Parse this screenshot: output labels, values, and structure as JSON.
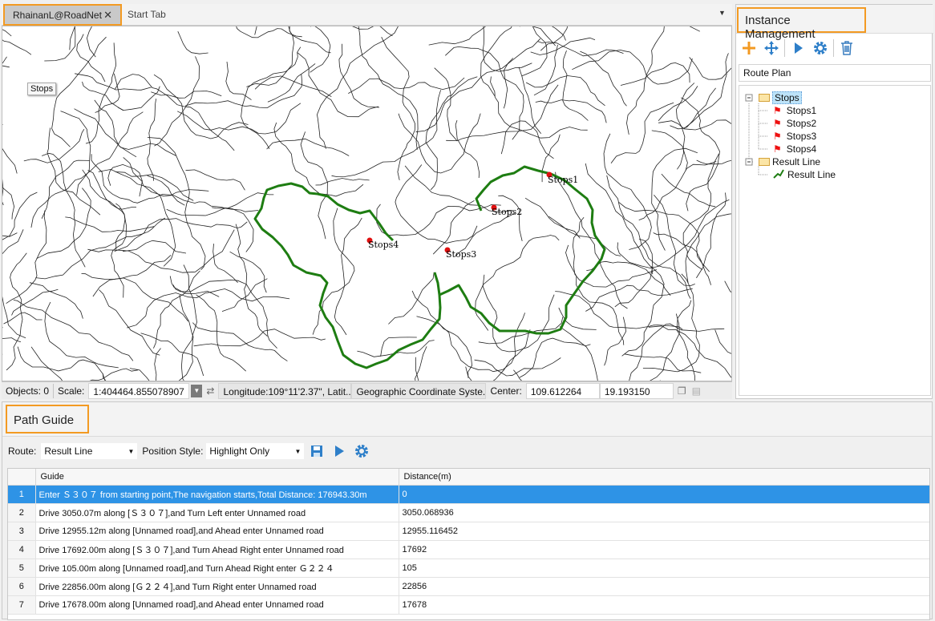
{
  "map_tabs": {
    "active": "RhainanL@RoadNet",
    "close_glyph": "✕",
    "inactive": "Start Tab",
    "dropdown_glyph": "▼"
  },
  "map": {
    "tooltip": "Stops",
    "stops": [
      {
        "label": "Stops1"
      },
      {
        "label": "Stops2"
      },
      {
        "label": "Stops3"
      },
      {
        "label": "Stops4"
      }
    ],
    "route_color": "#1e7d12",
    "stop_color": "#e01010"
  },
  "status_bar": {
    "objects_label": "Objects: 0",
    "scale_label": "Scale:",
    "scale_value": "1:404464.855078907",
    "longitude": "Longitude:109°11'2.37\", Latit...",
    "coord_system": "Geographic Coordinate Syste...",
    "center_label": "Center:",
    "center_x": "109.612264",
    "center_y": "19.193150"
  },
  "instance_panel": {
    "title": "Instance Management",
    "tools": [
      "add-icon",
      "move-icon",
      "run-icon",
      "settings-icon",
      "delete-icon"
    ],
    "route_plan": "Route Plan",
    "tree": {
      "stops_group": "Stops",
      "stops": [
        "Stops1",
        "Stops2",
        "Stops3",
        "Stops4"
      ],
      "result_group": "Result Line",
      "result_item": "Result Line"
    }
  },
  "path_guide": {
    "title": "Path Guide",
    "route_label": "Route:",
    "route_value": "Result Line",
    "position_label": "Position Style:",
    "position_value": "Highlight Only",
    "columns": [
      "Guide",
      "Distance(m)"
    ],
    "rows": [
      {
        "n": "1",
        "guide": "Enter Ｓ３０７ from starting point,The navigation starts,Total Distance: 176943.30m",
        "distance": "0"
      },
      {
        "n": "2",
        "guide": "Drive 3050.07m along [Ｓ３０７],and Turn Left enter Unnamed road",
        "distance": "3050.068936"
      },
      {
        "n": "3",
        "guide": "Drive 12955.12m along [Unnamed road],and Ahead enter Unnamed road",
        "distance": "12955.116452"
      },
      {
        "n": "4",
        "guide": "Drive 17692.00m along [Ｓ３０７],and Turn Ahead Right enter Unnamed road",
        "distance": "17692"
      },
      {
        "n": "5",
        "guide": "Drive 105.00m along [Unnamed road],and Turn Ahead Right enter Ｇ２２４",
        "distance": "105"
      },
      {
        "n": "6",
        "guide": "Drive 22856.00m along [Ｇ２２４],and Turn Right enter Unnamed road",
        "distance": "22856"
      },
      {
        "n": "7",
        "guide": "Drive 17678.00m along [Unnamed road],and Ahead enter Unnamed road",
        "distance": "17678"
      }
    ],
    "selected_row": "1",
    "selection_color": "#2e93e6"
  },
  "accent_color": "#f39a22"
}
